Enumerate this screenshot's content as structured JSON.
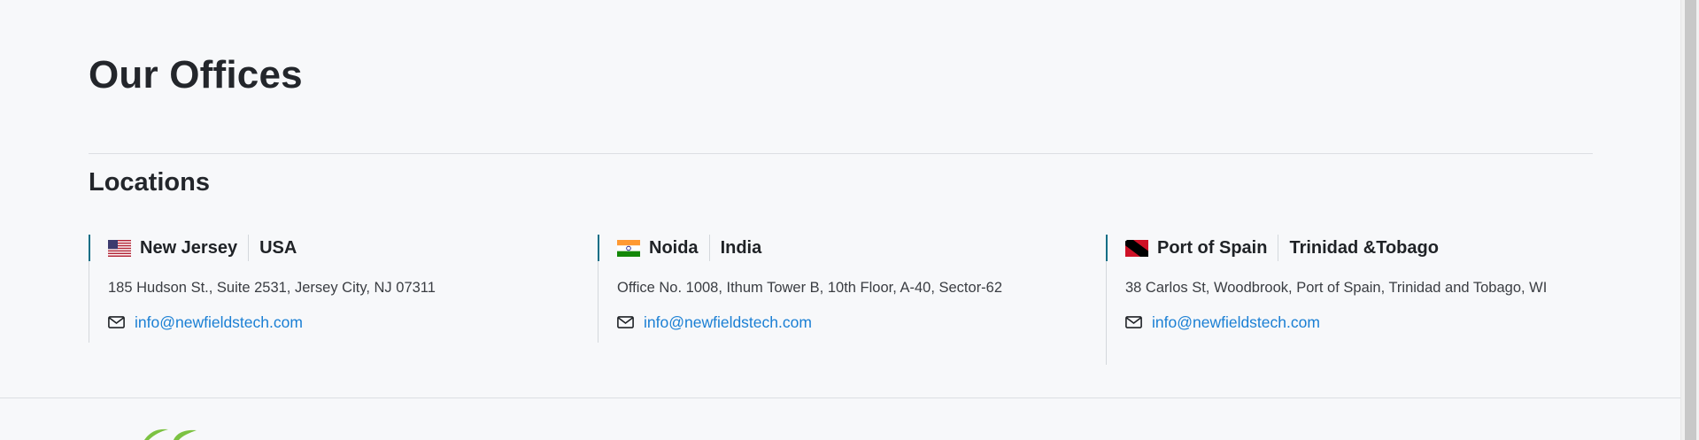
{
  "page_title": "Our Offices",
  "section_title": "Locations",
  "offices": [
    {
      "city": "New Jersey",
      "country": "USA",
      "flag_icon": "us-flag-icon",
      "address": "185 Hudson St., Suite 2531, Jersey City, NJ 07311",
      "email": "info@newfieldstech.com"
    },
    {
      "city": "Noida",
      "country": "India",
      "flag_icon": "india-flag-icon",
      "address": "Office No. 1008, Ithum Tower B, 10th Floor, A-40, Sector-62",
      "email": "info@newfieldstech.com"
    },
    {
      "city": "Port of Spain",
      "country": "Trinidad &Tobago",
      "flag_icon": "trinidad-tobago-flag-icon",
      "address": "38 Carlos St, Woodbrook, Port of Spain, Trinidad and Tobago, WI",
      "email": "info@newfieldstech.com"
    }
  ],
  "icons": {
    "mail": "mail-icon",
    "logo": "company-logo"
  },
  "colors": {
    "accent": "#0f6e86",
    "link": "#1a7fd4",
    "logo_green": "#7cc242"
  }
}
